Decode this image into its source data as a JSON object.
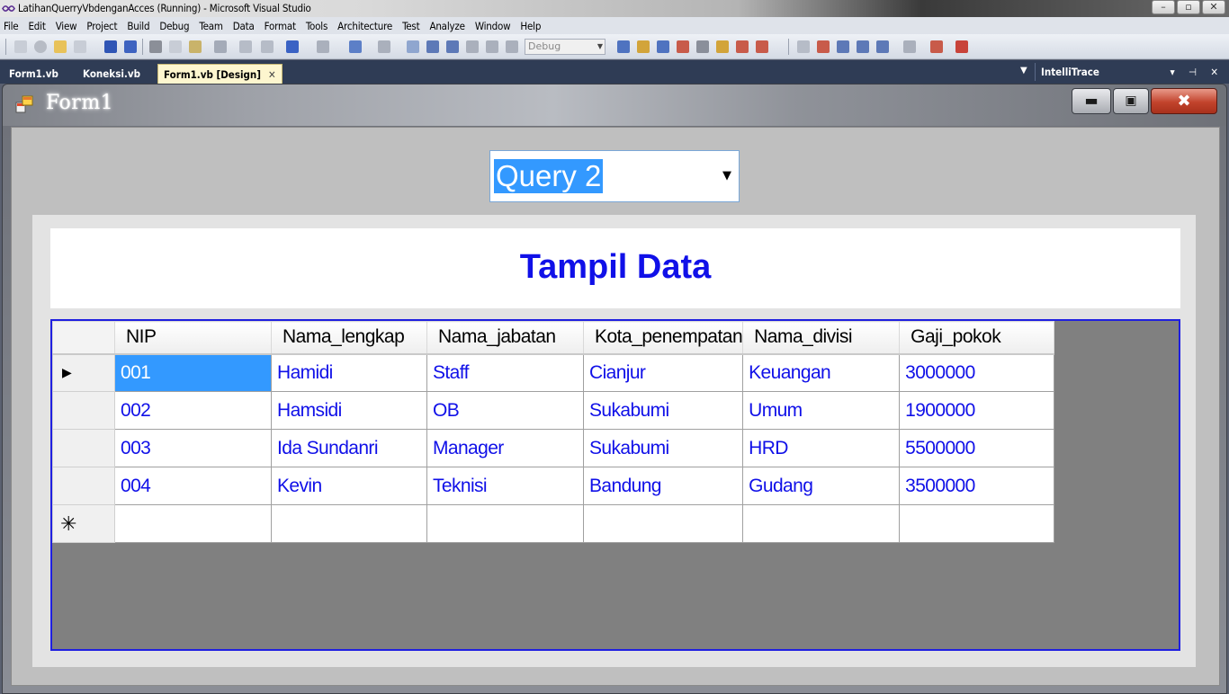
{
  "vs": {
    "title": "LatihanQuerryVbdenganAcces (Running) - Microsoft Visual Studio",
    "menu": [
      "File",
      "Edit",
      "View",
      "Project",
      "Build",
      "Debug",
      "Team",
      "Data",
      "Format",
      "Tools",
      "Architecture",
      "Test",
      "Analyze",
      "Window",
      "Help"
    ],
    "toolbar": {
      "configuration": "Debug"
    },
    "tabs": [
      {
        "label": "Form1.vb"
      },
      {
        "label": "Koneksi.vb"
      },
      {
        "label": "Form1.vb [Design]"
      }
    ],
    "tool_window": "IntelliTrace"
  },
  "form": {
    "title": "Form1",
    "combo": {
      "value": "Query 2"
    },
    "header_title": "Tampil Data",
    "grid": {
      "columns": [
        "NIP",
        "Nama_lengkap",
        "Nama_jabatan",
        "Kota_penempatan",
        "Nama_divisi",
        "Gaji_pokok"
      ],
      "rows": [
        [
          "001",
          "Hamidi",
          "Staff",
          "Cianjur",
          "Keuangan",
          "3000000"
        ],
        [
          "002",
          "Hamsidi",
          "OB",
          "Sukabumi",
          "Umum",
          "1900000"
        ],
        [
          "003",
          "Ida Sundanri",
          "Manager",
          "Sukabumi",
          "HRD",
          "5500000"
        ],
        [
          "004",
          "Kevin",
          "Teknisi",
          "Bandung",
          "Gudang",
          "3500000"
        ]
      ]
    }
  }
}
